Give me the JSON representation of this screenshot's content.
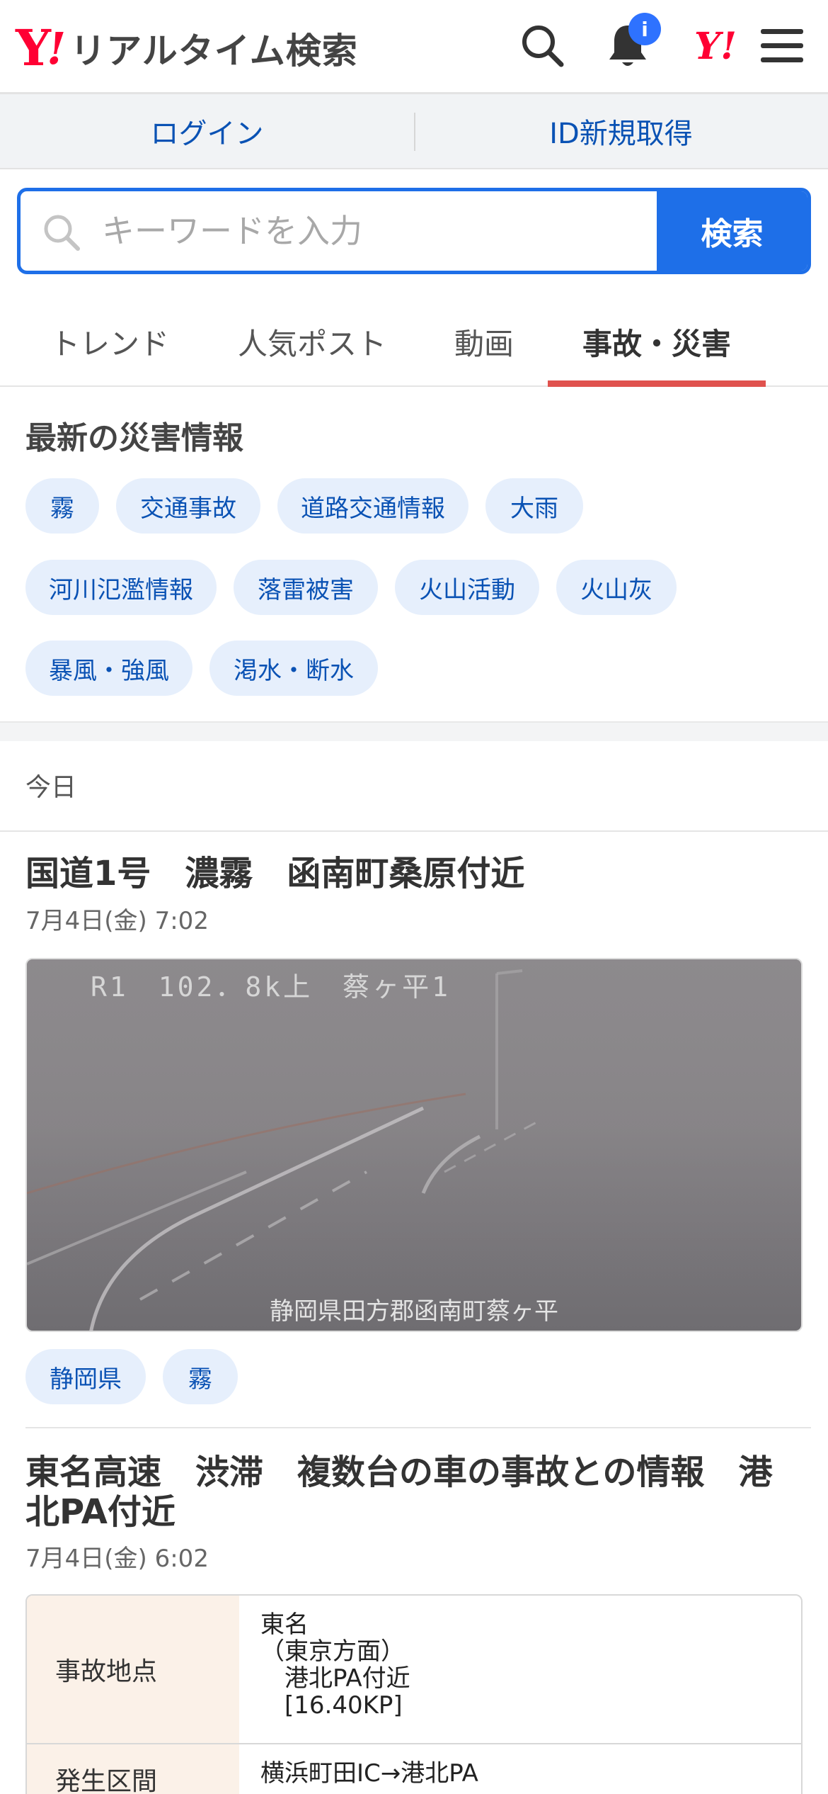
{
  "header": {
    "logo_y": "Y",
    "logo_ex": "!",
    "title": "リアルタイム検索",
    "notification_badge": "i",
    "ymark": "Y!"
  },
  "login_bar": {
    "login": "ログイン",
    "register": "ID新規取得"
  },
  "search": {
    "placeholder": "キーワードを入力",
    "button": "検索"
  },
  "tabs": [
    {
      "label": "トレンド"
    },
    {
      "label": "人気ポスト"
    },
    {
      "label": "動画"
    },
    {
      "label": "事故・災害",
      "active": true
    }
  ],
  "disaster": {
    "title": "最新の災害情報",
    "chips": [
      "霧",
      "交通事故",
      "道路交通情報",
      "大雨",
      "河川氾濫情報",
      "落雷被害",
      "火山活動",
      "火山灰",
      "暴風・強風",
      "渇水・断水"
    ]
  },
  "day_label": "今日",
  "articles": [
    {
      "title": "国道1号　濃霧　函南町桑原付近",
      "time": "7月4日(金) 7:02",
      "camera_top": "R1　102．8k上　蔡ヶ平1",
      "camera_bottom": "静岡県田方郡函南町蔡ヶ平",
      "tags": [
        "静岡県",
        "霧"
      ]
    },
    {
      "title": "東名高速　渋滞　複数台の車の事故との情報　港北PA付近",
      "time": "7月4日(金) 6:02",
      "table": [
        {
          "label": "事故地点",
          "lines": [
            "東名",
            "（東京方面）",
            "　港北PA付近",
            "　[16.40KP]"
          ]
        },
        {
          "label": "発生区間",
          "lines": [
            "横浜町田IC→港北PA"
          ]
        }
      ]
    }
  ],
  "colors": {
    "accent": "#1e6fe8",
    "brand_red": "#ff0033",
    "tab_underline": "#e0524e",
    "chip_bg": "#e6effc",
    "link": "#0a52b4"
  }
}
